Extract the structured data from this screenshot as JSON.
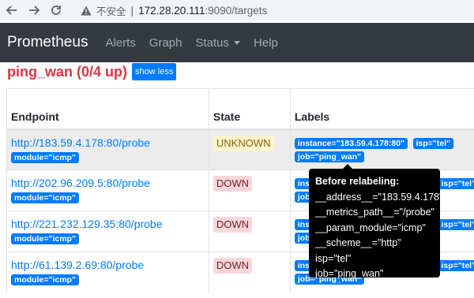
{
  "browser": {
    "insecure_label": "不安全",
    "url_host": "172.28.20.111",
    "url_path": ":9090/targets"
  },
  "navbar": {
    "brand": "Prometheus",
    "items": [
      {
        "label": "Alerts"
      },
      {
        "label": "Graph"
      },
      {
        "label": "Status"
      },
      {
        "label": "Help"
      }
    ]
  },
  "pool": {
    "title": "ping_wan (0/4 up)",
    "toggle_label": "show less"
  },
  "table": {
    "headers": {
      "endpoint": "Endpoint",
      "state": "State",
      "labels": "Labels"
    },
    "rows": [
      {
        "endpoint": "http://183.59.4.178:80/probe",
        "module": "module=\"icmp\"",
        "state": "UNKNOWN",
        "labels": [
          "instance=\"183.59.4.178:80\"",
          "isp=\"tel\"",
          "job=\"ping_wan\""
        ]
      },
      {
        "endpoint": "http://202.96.209.5:80/probe",
        "module": "module=\"icmp\"",
        "state": "DOWN",
        "labels": [
          "ins",
          "isp=\"tel\"",
          "job"
        ]
      },
      {
        "endpoint": "http://221.232.129.35:80/probe",
        "module": "module=\"icmp\"",
        "state": "DOWN",
        "labels": [
          "ins",
          "isp=\"tel\"",
          "job"
        ]
      },
      {
        "endpoint": "http://61.139.2.69:80/probe",
        "module": "module=\"icmp\"",
        "state": "DOWN",
        "labels": [
          "ins",
          "isp=\"tel\"",
          "job=\"ping_wan\""
        ]
      }
    ]
  },
  "tooltip": {
    "title": "Before relabeling:",
    "lines": [
      "__address__=\"183.59.4.178\"",
      "__metrics_path__=\"/probe\"",
      "__param_module=\"icmp\"",
      "__scheme__=\"http\"",
      "isp=\"tel\"",
      "job=\"ping_wan\""
    ]
  },
  "colors": {
    "navbar_bg": "#343a40",
    "accent": "#007bff",
    "pool_title": "#dc3545",
    "state_unknown_bg": "#fff3cd",
    "state_down_bg": "#f8d7da"
  }
}
